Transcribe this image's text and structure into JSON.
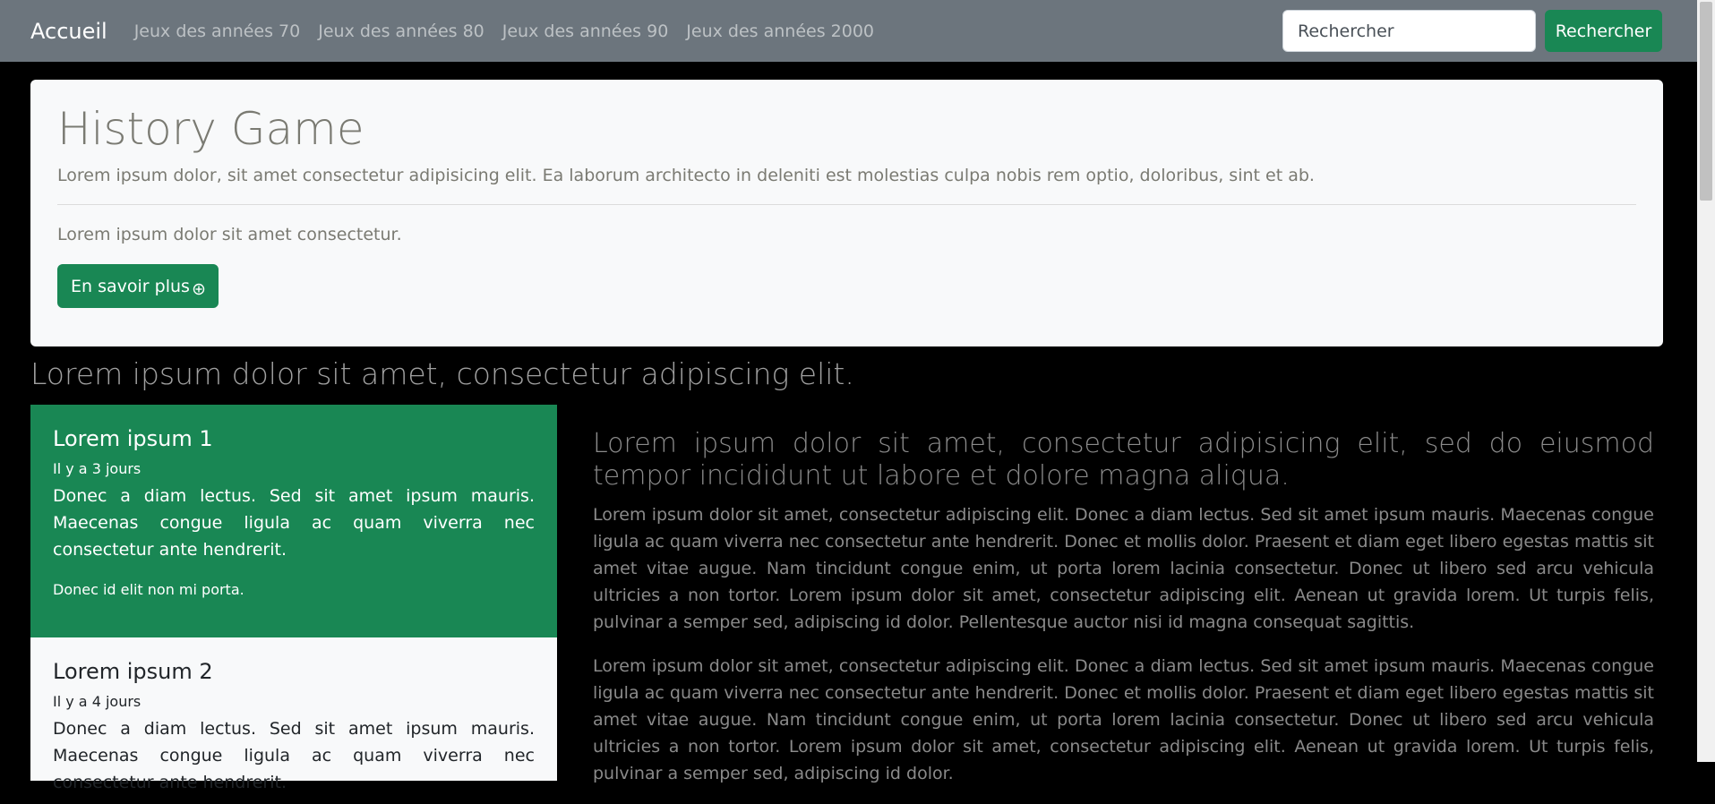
{
  "navbar": {
    "brand": "Accueil",
    "links": [
      "Jeux des années 70",
      "Jeux des années 80",
      "Jeux des années 90",
      "Jeux des années 2000"
    ],
    "search_placeholder": "Rechercher",
    "search_button": "Rechercher"
  },
  "jumbotron": {
    "title": "History Game",
    "lead": "Lorem ipsum dolor, sit amet consectetur adipisicing elit. Ea laborum architecto in deleniti est molestias culpa nobis rem optio, doloribus, sint et ab.",
    "text": "Lorem ipsum dolor sit amet consectetur.",
    "button": "En savoir plus",
    "button_icon": "plus-circle-icon"
  },
  "section": {
    "heading": "Lorem ipsum dolor sit amet, consectetur adipiscing elit."
  },
  "cards": [
    {
      "title": "Lorem ipsum 1",
      "time": "Il y a 3 jours",
      "body": "Donec a diam lectus. Sed sit amet ipsum mauris. Maecenas congue ligula ac quam viverra nec consectetur ante hendrerit.",
      "foot": "Donec id elit non mi porta."
    },
    {
      "title": "Lorem ipsum 2",
      "time": "Il y a 4 jours",
      "body": "Donec a diam lectus. Sed sit amet ipsum mauris. Maecenas congue ligula ac quam viverra nec consectetur ante hendrerit."
    }
  ],
  "article": {
    "title": "Lorem ipsum dolor sit amet, consectetur adipisicing elit, sed do eiusmod tempor incididunt ut labore et dolore magna aliqua.",
    "paragraphs": [
      "Lorem ipsum dolor sit amet, consectetur adipiscing elit. Donec a diam lectus. Sed sit amet ipsum mauris. Maecenas congue ligula ac quam viverra nec consectetur ante hendrerit. Donec et mollis dolor. Praesent et diam eget libero egestas mattis sit amet vitae augue. Nam tincidunt congue enim, ut porta lorem lacinia consectetur. Donec ut libero sed arcu vehicula ultricies a non tortor. Lorem ipsum dolor sit amet, consectetur adipiscing elit. Aenean ut gravida lorem. Ut turpis felis, pulvinar a semper sed, adipiscing id dolor. Pellentesque auctor nisi id magna consequat sagittis.",
      "Lorem ipsum dolor sit amet, consectetur adipiscing elit. Donec a diam lectus. Sed sit amet ipsum mauris. Maecenas congue ligula ac quam viverra nec consectetur ante hendrerit. Donec et mollis dolor. Praesent et diam eget libero egestas mattis sit amet vitae augue. Nam tincidunt congue enim, ut porta lorem lacinia consectetur. Donec ut libero sed arcu vehicula ultricies a non tortor. Lorem ipsum dolor sit amet, consectetur adipiscing elit. Aenean ut gravida lorem. Ut turpis felis, pulvinar a semper sed, adipiscing id dolor."
    ]
  },
  "colors": {
    "navbar": "#6c757d",
    "accent": "#198754",
    "background": "#000000",
    "panel": "#f8f9fa"
  }
}
